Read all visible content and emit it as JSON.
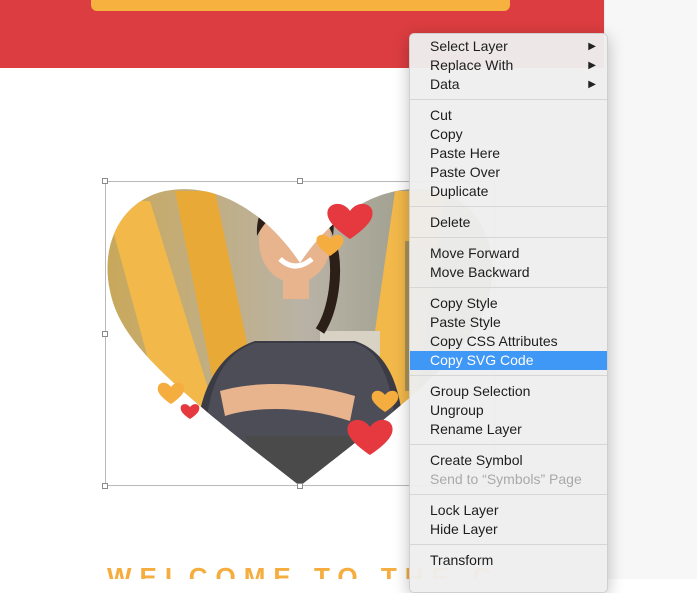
{
  "canvas": {
    "welcome_text": "WELCOME TO THE C"
  },
  "context_menu": {
    "groups": [
      [
        {
          "label": "Select Layer",
          "submenu": true
        },
        {
          "label": "Replace With",
          "submenu": true
        },
        {
          "label": "Data",
          "submenu": true
        }
      ],
      [
        {
          "label": "Cut"
        },
        {
          "label": "Copy"
        },
        {
          "label": "Paste Here"
        },
        {
          "label": "Paste Over"
        },
        {
          "label": "Duplicate"
        }
      ],
      [
        {
          "label": "Delete"
        }
      ],
      [
        {
          "label": "Move Forward"
        },
        {
          "label": "Move Backward"
        }
      ],
      [
        {
          "label": "Copy Style"
        },
        {
          "label": "Paste Style"
        },
        {
          "label": "Copy CSS Attributes"
        },
        {
          "label": "Copy SVG Code",
          "highlighted": true
        }
      ],
      [
        {
          "label": "Group Selection"
        },
        {
          "label": "Ungroup"
        },
        {
          "label": "Rename Layer"
        }
      ],
      [
        {
          "label": "Create Symbol"
        },
        {
          "label": "Send to “Symbols” Page",
          "disabled": true
        }
      ],
      [
        {
          "label": "Lock Layer"
        },
        {
          "label": "Hide Layer"
        }
      ],
      [
        {
          "label": "Transform"
        }
      ]
    ]
  },
  "colors": {
    "banner_red": "#dc3d40",
    "button_yellow": "#f6b13e",
    "heart_red": "#e5393f",
    "heart_yellow": "#f6ad3f",
    "menu_highlight": "#3f97f6"
  }
}
